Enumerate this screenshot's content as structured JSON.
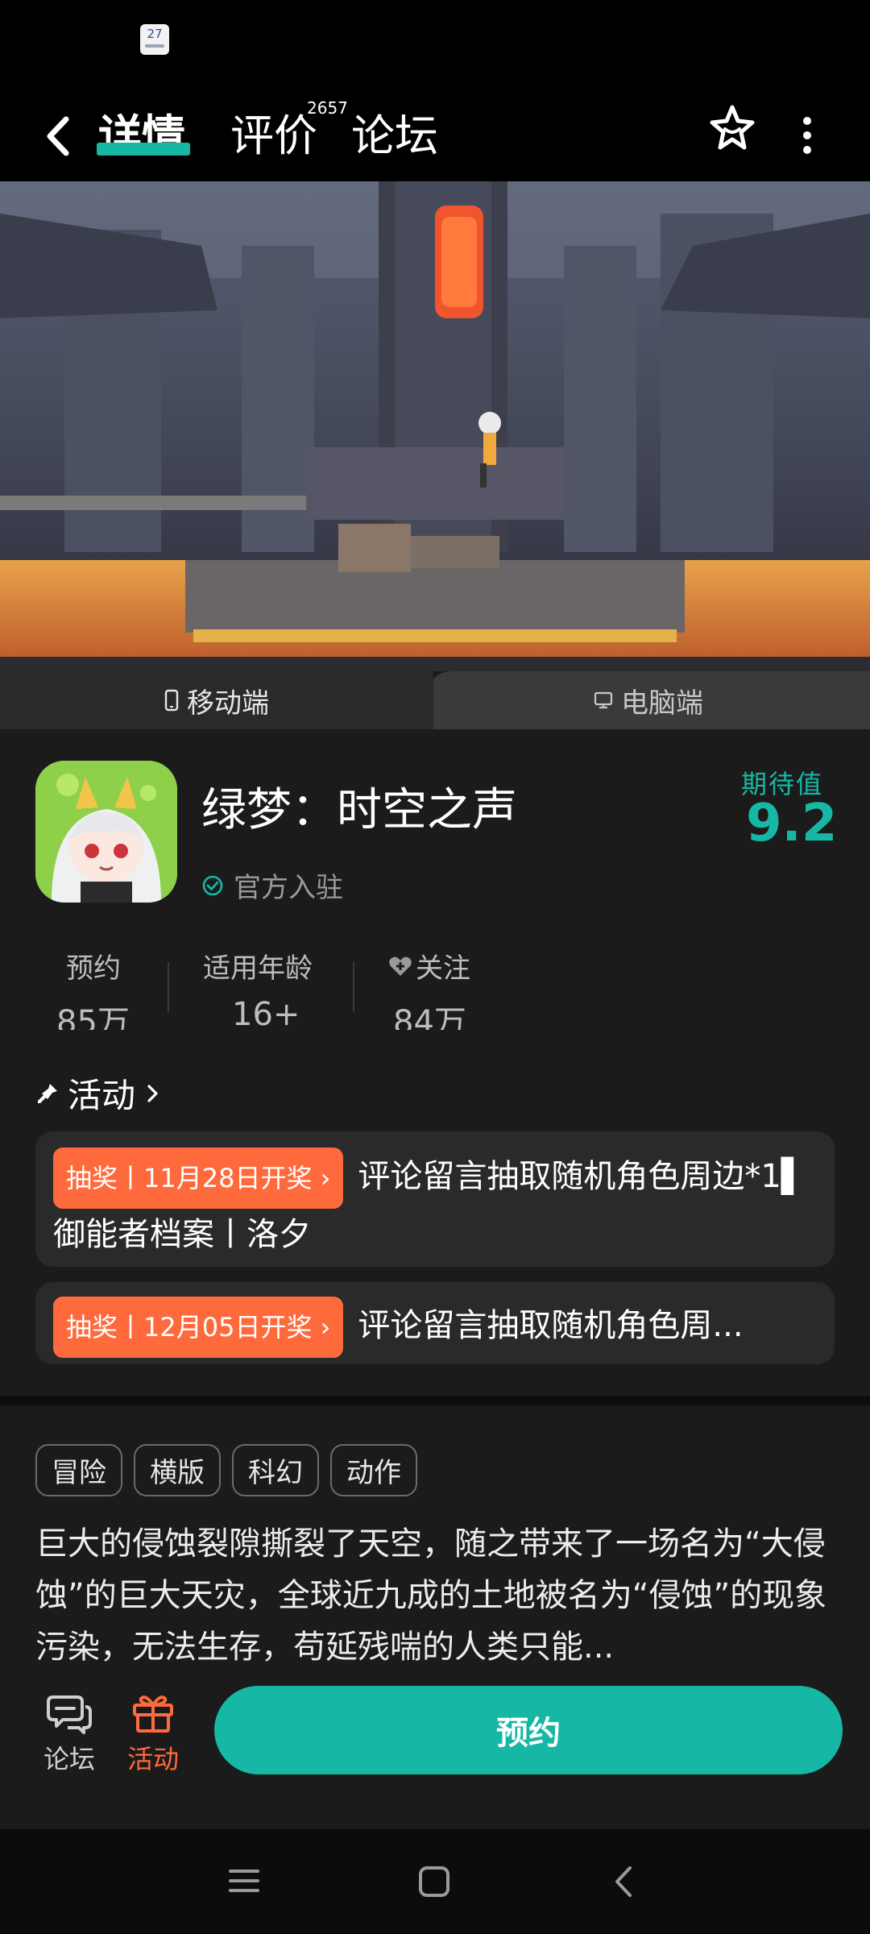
{
  "status_bar": {
    "calendar_day": "27"
  },
  "nav": {
    "tabs": [
      {
        "label": "详情"
      },
      {
        "label": "评价",
        "badge": "2657"
      },
      {
        "label": "论坛"
      }
    ]
  },
  "platform": {
    "mobile": "移动端",
    "pc": "电脑端"
  },
  "app": {
    "title": "绿梦：时空之声",
    "official": "官方入驻",
    "expect_label": "期待值",
    "expect_score": "9.2"
  },
  "stats": [
    {
      "label": "预约",
      "value": "85万"
    },
    {
      "label": "适用年龄",
      "value": "16+"
    },
    {
      "label": "关注",
      "value": "84万"
    }
  ],
  "activity": {
    "heading": "活动",
    "items": [
      {
        "badge": "抽奖丨11月28日开奖",
        "text": "评论留言抽取随机角色周边*1▌ 御能者档案丨洛夕"
      },
      {
        "badge": "抽奖丨12月05日开奖",
        "text": "评论留言抽取随机角色周..."
      }
    ]
  },
  "tags": [
    "冒险",
    "横版",
    "科幻",
    "动作"
  ],
  "description": "巨大的侵蚀裂隙撕裂了天空，随之带来了一场名为“大侵蚀”的巨大天灾，全球近九成的土地被名为“侵蚀”的现象污染，无法生存，苟延残喘的人类只能...",
  "bottom_bar": {
    "forum": "论坛",
    "activity": "活动",
    "reserve": "预约"
  },
  "colors": {
    "accent": "#16b8a5",
    "badge": "#ff6a3d",
    "background": "#1b1b1b"
  }
}
